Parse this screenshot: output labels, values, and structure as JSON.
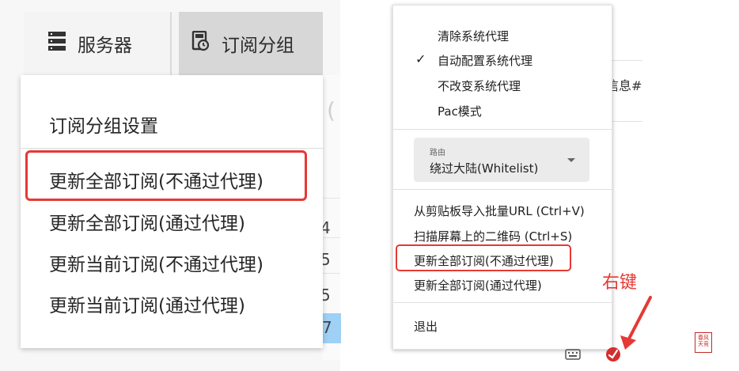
{
  "left": {
    "toolbar": {
      "servers_label": "服务器",
      "subscription_group_label": "订阅分组",
      "servers_icon": "server-rack-icon",
      "subscription_icon": "subscription-clock-icon"
    },
    "menu": {
      "settings": "订阅分组设置",
      "update_all_no_proxy": "更新全部订阅(不通过代理)",
      "update_all_proxy": "更新全部订阅(通过代理)",
      "update_current_no_proxy": "更新当前订阅(不通过代理)",
      "update_current_proxy": "更新当前订阅(通过代理)"
    },
    "background_digits": [
      "4",
      "5",
      "5",
      "7"
    ]
  },
  "right": {
    "context_menu": {
      "clear_proxy": "清除系统代理",
      "auto_proxy": "自动配置系统代理",
      "keep_proxy": "不改变系统代理",
      "pac_mode": "Pac模式",
      "route_label": "路由",
      "route_value": "绕过大陆(Whitelist)",
      "import_clipboard": "从剪贴板导入批量URL (Ctrl+V)",
      "scan_qr": "扫描屏幕上的二维码 (Ctrl+S)",
      "update_all_no_proxy": "更新全部订阅(不通过代理)",
      "update_all_proxy": "更新全部订阅(通过代理)",
      "exit": "退出"
    },
    "background_text": "信息#",
    "annotation": "右键",
    "seal_text": "春风\n天竞",
    "accent_color": "#e53935"
  }
}
